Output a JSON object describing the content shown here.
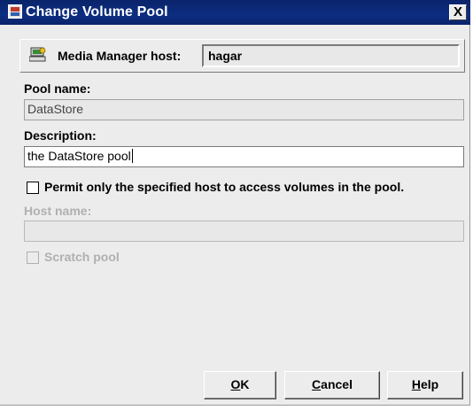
{
  "window": {
    "title": "Change Volume Pool",
    "close_label": "X"
  },
  "host": {
    "label": "Media Manager host:",
    "value": "hagar",
    "icon": "server-host-icon"
  },
  "pool_name": {
    "label": "Pool name:",
    "value": "DataStore"
  },
  "description": {
    "label": "Description:",
    "value": "the DataStore pool"
  },
  "permit_host": {
    "label": "Permit only the specified host to access volumes in the pool.",
    "checked": false
  },
  "host_name": {
    "label": "Host name:",
    "value": ""
  },
  "scratch_pool": {
    "label": "Scratch pool",
    "checked": false
  },
  "buttons": {
    "ok": {
      "mnemonic": "O",
      "rest": "K"
    },
    "cancel": {
      "mnemonic": "C",
      "rest": "ancel"
    },
    "help": {
      "mnemonic": "H",
      "rest": "elp"
    }
  },
  "colors": {
    "titlebar": "#0a246a",
    "dialog_bg": "#ececec",
    "disabled_text": "#b0b0b0"
  }
}
